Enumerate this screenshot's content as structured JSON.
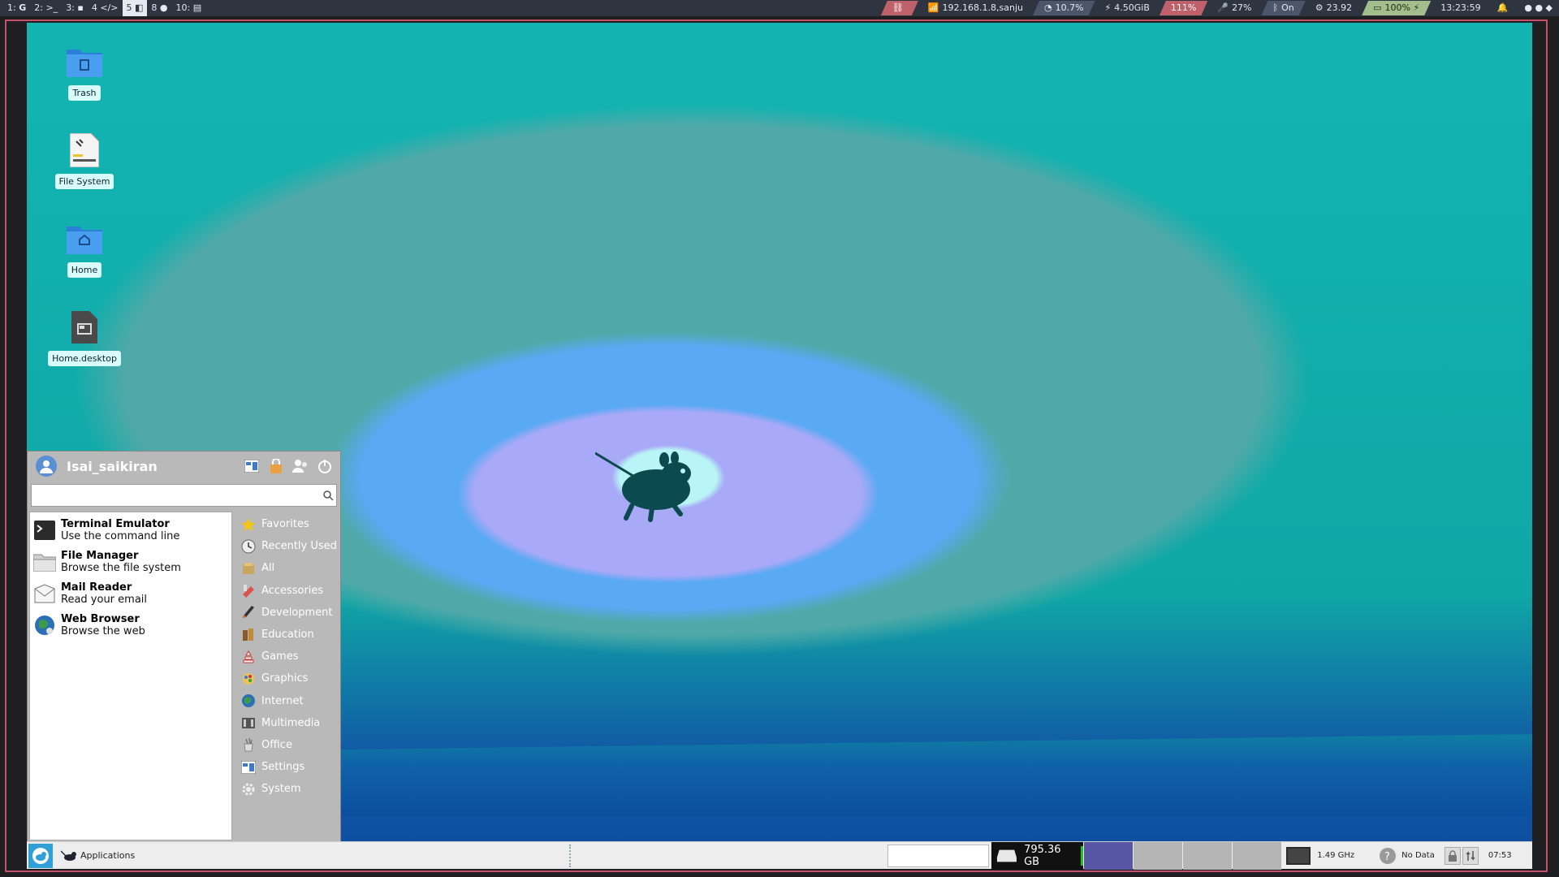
{
  "topbar": {
    "workspaces": [
      {
        "label": "1:",
        "icon": "G",
        "active": false
      },
      {
        "label": "2:",
        "icon": ">_",
        "active": false
      },
      {
        "label": "3:",
        "icon": "▪",
        "active": false
      },
      {
        "label": "4",
        "icon": "</>",
        "active": false
      },
      {
        "label": "5",
        "icon": "◧",
        "active": true
      },
      {
        "label": "8",
        "icon": "●",
        "active": false
      },
      {
        "label": "10:",
        "icon": "▤",
        "active": false
      }
    ],
    "status": {
      "vpn": "",
      "network": "192.168.1.8,sanju",
      "cpu": "10.7%",
      "memory": "4.50GiB",
      "load": "111%",
      "mic": "27%",
      "bluetooth": "On",
      "temperature": "23.92",
      "battery": "100%",
      "time": "13:23:59"
    }
  },
  "desktop_icons": [
    {
      "label": "Trash",
      "icon": "trash-folder-icon"
    },
    {
      "label": "File System",
      "icon": "drive-icon"
    },
    {
      "label": "Home",
      "icon": "home-folder-icon"
    },
    {
      "label": "Home.desktop",
      "icon": "desktop-file-icon"
    }
  ],
  "menu": {
    "username": "Isai_saikiran",
    "search": {
      "value": "",
      "placeholder": ""
    },
    "apps": [
      {
        "name": "Terminal Emulator",
        "desc": "Use the command line",
        "icon": "terminal-icon"
      },
      {
        "name": "File Manager",
        "desc": "Browse the file system",
        "icon": "file-manager-icon"
      },
      {
        "name": "Mail Reader",
        "desc": "Read your email",
        "icon": "mail-icon"
      },
      {
        "name": "Web Browser",
        "desc": "Browse the web",
        "icon": "web-browser-icon"
      }
    ],
    "categories": [
      {
        "label": "Favorites",
        "icon": "star-icon"
      },
      {
        "label": "Recently Used",
        "icon": "clock-icon"
      },
      {
        "label": "All",
        "icon": "all-apps-icon"
      },
      {
        "label": "Accessories",
        "icon": "accessories-icon"
      },
      {
        "label": "Development",
        "icon": "development-icon"
      },
      {
        "label": "Education",
        "icon": "education-icon"
      },
      {
        "label": "Games",
        "icon": "games-icon"
      },
      {
        "label": "Graphics",
        "icon": "graphics-icon"
      },
      {
        "label": "Internet",
        "icon": "internet-icon"
      },
      {
        "label": "Multimedia",
        "icon": "multimedia-icon"
      },
      {
        "label": "Office",
        "icon": "office-icon"
      },
      {
        "label": "Settings",
        "icon": "settings-icon"
      },
      {
        "label": "System",
        "icon": "system-icon"
      }
    ]
  },
  "panel": {
    "applications_label": "Applications",
    "disk_free": "795.36 GB",
    "cpu_freq": "1.49 GHz",
    "weather": "No Data",
    "clock": "07:53"
  },
  "colors": {
    "accent": "#2fa0d8",
    "workspace_current": "#5656a5",
    "warn": "#bf616a",
    "good": "#a3be8c"
  }
}
